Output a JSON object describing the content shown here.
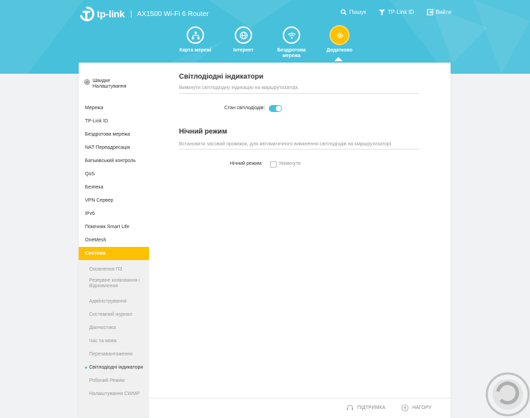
{
  "header": {
    "logo_text": "tp-link",
    "model": "AX1500 Wi-Fi 6 Router",
    "actions": [
      {
        "label": "Пошук",
        "icon": "search-icon"
      },
      {
        "label": "TP-Link ID",
        "icon": "tplink-id-icon"
      },
      {
        "label": "Вийти",
        "icon": "logout-icon"
      }
    ]
  },
  "nav": {
    "tabs": [
      {
        "label": "Карта мережі",
        "icon": "network-map-icon",
        "active": false
      },
      {
        "label": "Інтернет",
        "icon": "globe-icon",
        "active": false
      },
      {
        "label": "Бездротова мережа",
        "icon": "wifi-icon",
        "active": false
      },
      {
        "label": "Додатково",
        "icon": "gear-icon",
        "active": true
      }
    ]
  },
  "sidebar": {
    "quick_setup": "Швидке Налаштування",
    "items": [
      "Мережа",
      "TP-Link ID",
      "Бездротова мережа",
      "NAT Переадресація",
      "Батьківський контроль",
      "QoS",
      "Безпека",
      "VPN Сервер",
      "IPv6",
      "Помічник Smart Life",
      "OneMesh",
      "Система"
    ],
    "active_item": "Система",
    "submenu": [
      "Оновлення ПЗ",
      "Резервне копіювання і Відновлення",
      "Адміністрування",
      "Системний журнал",
      "Діагностика",
      "Час та мова",
      "Перезавантаження",
      "Світлодіодні індикатори",
      "Робочий Режим",
      "Налаштування CWMP"
    ],
    "active_sub": "Світлодіодні індикатори"
  },
  "led": {
    "title": "Світлодіодні індикатори",
    "description": "Вимкнути світлодіодну індикацію на маршрутизаторі.",
    "status_label": "Стан світлодіодів:",
    "status_on": true
  },
  "night": {
    "title": "Нічний режим",
    "description": "Встановити часовий проміжок, для автоматичного вимкнення світлодіодів на маршрутизаторі.",
    "label": "Нічний режим:",
    "checkbox_label": "Увімкнути",
    "enabled": false
  },
  "footer": {
    "support": "ПІДТРИМКА",
    "top": "НАГОРУ"
  },
  "colors": {
    "header": "#47c0dc",
    "accent": "#ffc000",
    "toggle": "#47c0dc"
  }
}
